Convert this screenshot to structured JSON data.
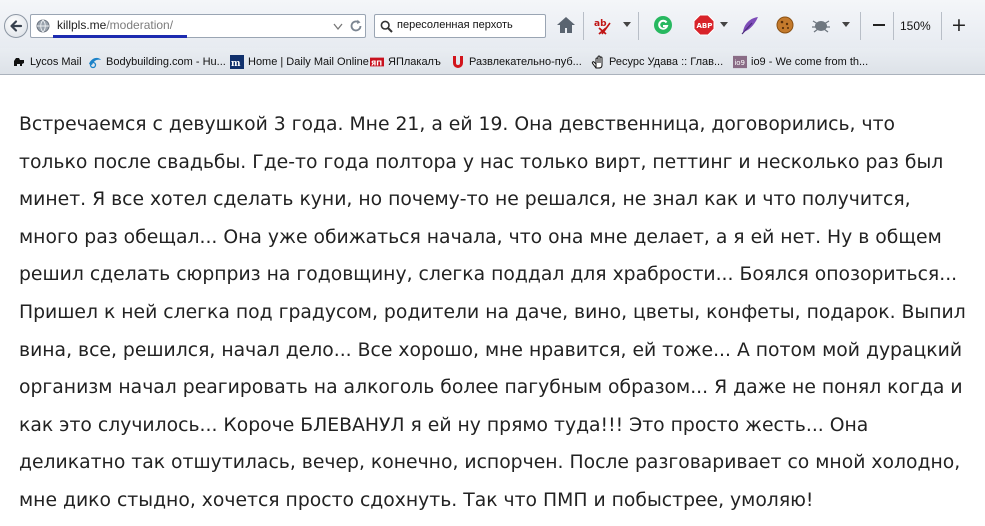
{
  "browser": {
    "url_domain": "killpls.me",
    "url_path": "/moderation/",
    "search_value": "пересоленная перхоть",
    "zoom": "150%",
    "zoom_plus": "+",
    "toolbar_icons": [
      "home-icon",
      "spellcheck-icon",
      "grammarly-icon",
      "adblock-icon",
      "feather-icon",
      "cookie-icon",
      "bug-icon"
    ]
  },
  "bookmarks": [
    {
      "label": "Lycos Mail",
      "icon": "dog-icon"
    },
    {
      "label": "Bodybuilding.com - Hu...",
      "icon": "bodybuilding-icon"
    },
    {
      "label": "Home | Daily Mail Online",
      "icon": "dailymail-icon"
    },
    {
      "label": "ЯПлакалъ",
      "icon": "yaplakal-icon"
    },
    {
      "label": "Развлекательно-пуб...",
      "icon": "umax-icon"
    },
    {
      "label": "Ресурс Удава :: Глав...",
      "icon": "hand-icon"
    },
    {
      "label": "io9 - We come from th...",
      "icon": "io9-icon"
    }
  ],
  "story": {
    "text": "Встречаемся с девушкой 3 года. Мне 21, а ей 19. Она девственница, договорились, что только после свадьбы. Где-то года полтора у нас только вирт, петтинг и несколько раз был минет. Я все хотел сделать куни, но почему-то не решался, не знал как и что получится, много раз обещал... Она уже обижаться начала, что она мне делает, а я ей нет. Ну в общем решил сделать сюрприз на годовщину, слегка поддал для храбрости... Боялся опозориться... Пришел к ней слегка под градусом, родители на даче, вино, цветы, конфеты, подарок. Выпил вина, все, решился, начал дело... Все хорошо, мне нравится, ей тоже... А потом мой дурацкий организм начал реагировать на алкоголь более пагубным образом... Я даже не понял когда и как это случилось... Короче БЛЕВАНУЛ я ей ну прямо туда!!! Это просто жесть... Она деликатно так отшутилась, вечер, конечно, испорчен. После разговаривает со мной холодно, мне дико стыдно, хочется просто сдохнуть. Так что ПМП и побыстрее, умоляю!"
  }
}
